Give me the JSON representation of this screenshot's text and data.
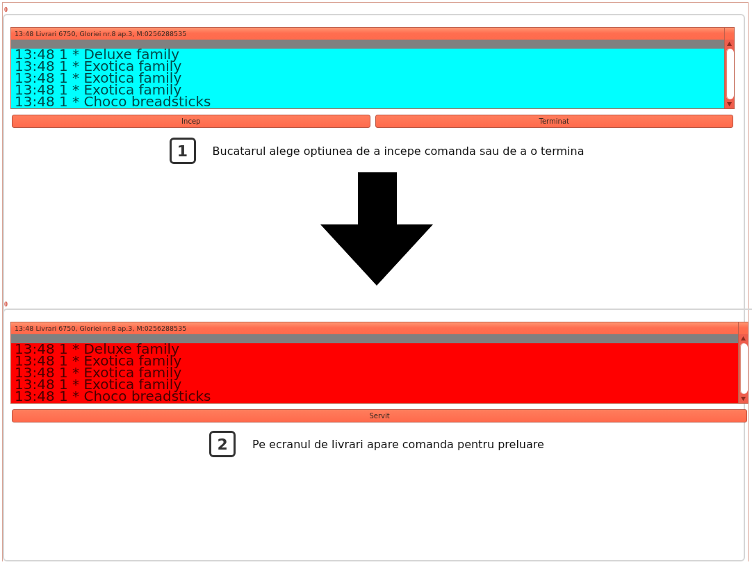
{
  "steps": [
    {
      "screen": {
        "counter": "0",
        "header": "13:48 Livrari 6750, Gloriei nr.8 ap.3, M:0256288535",
        "color": "#00ffff",
        "items": [
          "13:48 1 * Deluxe family",
          "13:48 1 * Exotica family",
          "13:48 1 * Exotica family",
          "13:48 1 * Exotica family",
          "13:48 1 * Choco breadsticks"
        ],
        "buttons": [
          "Incep",
          "Terminat"
        ]
      },
      "number": "1",
      "caption": "Bucatarul alege optiunea de a incepe comanda sau de a o termina"
    },
    {
      "screen": {
        "counter": "0",
        "header": "13:48 Livrari 6750, Gloriei nr.8 ap.3, M:0256288535",
        "color": "#ff0000",
        "items": [
          "13:48 1 * Deluxe family",
          "13:48 1 * Exotica family",
          "13:48 1 * Exotica family",
          "13:48 1 * Exotica family",
          "13:48 1 * Choco breadsticks"
        ],
        "buttons": [
          "Servit"
        ]
      },
      "number": "2",
      "caption": "Pe ecranul de livrari apare comanda pentru preluare"
    }
  ]
}
